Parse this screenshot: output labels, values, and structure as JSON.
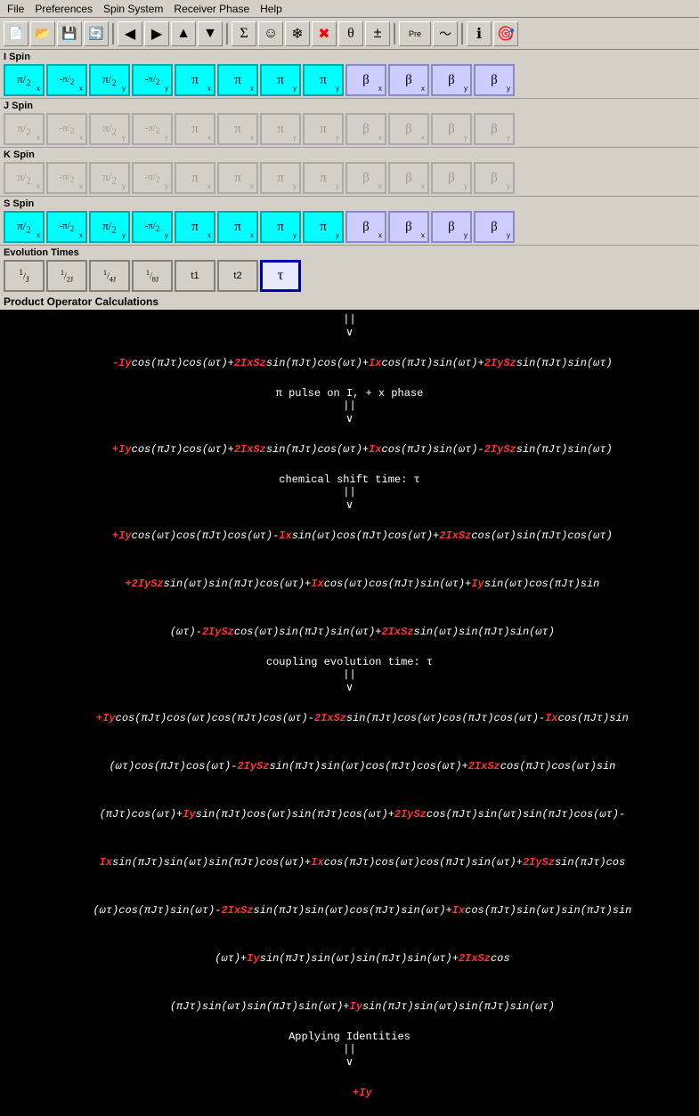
{
  "menubar": {
    "items": [
      "File",
      "Preferences",
      "Spin System",
      "Receiver Phase",
      "Help"
    ]
  },
  "toolbar": {
    "buttons": [
      {
        "name": "new",
        "icon": "📄"
      },
      {
        "name": "open",
        "icon": "📂"
      },
      {
        "name": "save",
        "icon": "💾"
      },
      {
        "name": "refresh",
        "icon": "🔄"
      },
      {
        "name": "back",
        "icon": "◀"
      },
      {
        "name": "forward",
        "icon": "▶"
      },
      {
        "name": "up",
        "icon": "▲"
      },
      {
        "name": "down",
        "icon": "▼"
      },
      {
        "name": "sigma",
        "icon": "Σ"
      },
      {
        "name": "smiley",
        "icon": "☺"
      },
      {
        "name": "asterisk",
        "icon": "✳"
      },
      {
        "name": "red-x",
        "icon": "✖"
      },
      {
        "name": "theta",
        "icon": "θ"
      },
      {
        "name": "plusminus",
        "icon": "±"
      },
      {
        "name": "preview",
        "icon": "Pre"
      },
      {
        "name": "wave",
        "icon": "〜"
      },
      {
        "name": "info",
        "icon": "ℹ"
      },
      {
        "name": "target",
        "icon": "🎯"
      }
    ]
  },
  "iSpin": {
    "label": "I Spin",
    "buttons": [
      {
        "label": "π/2",
        "sub": "x",
        "style": "cyan"
      },
      {
        "label": "-π/2",
        "sub": "x",
        "style": "cyan"
      },
      {
        "label": "π/2",
        "sub": "y",
        "style": "cyan"
      },
      {
        "label": "-π/2",
        "sub": "y",
        "style": "cyan"
      },
      {
        "label": "π",
        "sub": "x",
        "style": "cyan"
      },
      {
        "label": "π",
        "sub": "x",
        "style": "cyan"
      },
      {
        "label": "π",
        "sub": "y",
        "style": "cyan"
      },
      {
        "label": "π",
        "sub": "y",
        "style": "cyan"
      },
      {
        "label": "β",
        "sub": "x",
        "style": "lavender"
      },
      {
        "label": "β",
        "sub": "x",
        "style": "lavender"
      },
      {
        "label": "β",
        "sub": "y",
        "style": "lavender"
      },
      {
        "label": "β",
        "sub": "y",
        "style": "lavender"
      }
    ]
  },
  "jSpin": {
    "label": "J Spin",
    "buttons": [
      {
        "label": "π/2",
        "sub": "x",
        "style": "disabled"
      },
      {
        "label": "-π/2",
        "sub": "x",
        "style": "disabled"
      },
      {
        "label": "π/2",
        "sub": "y",
        "style": "disabled"
      },
      {
        "label": "-π/2",
        "sub": "y",
        "style": "disabled"
      },
      {
        "label": "π",
        "sub": "x",
        "style": "disabled"
      },
      {
        "label": "π",
        "sub": "x",
        "style": "disabled"
      },
      {
        "label": "π",
        "sub": "y",
        "style": "disabled"
      },
      {
        "label": "π",
        "sub": "y",
        "style": "disabled"
      },
      {
        "label": "β",
        "sub": "x",
        "style": "disabled"
      },
      {
        "label": "β",
        "sub": "x",
        "style": "disabled"
      },
      {
        "label": "β",
        "sub": "y",
        "style": "disabled"
      },
      {
        "label": "β",
        "sub": "y",
        "style": "disabled"
      }
    ]
  },
  "kSpin": {
    "label": "K Spin",
    "buttons": [
      {
        "label": "π/2",
        "sub": "x",
        "style": "disabled"
      },
      {
        "label": "-π/2",
        "sub": "x",
        "style": "disabled"
      },
      {
        "label": "π/2",
        "sub": "y",
        "style": "disabled"
      },
      {
        "label": "-π/2",
        "sub": "y",
        "style": "disabled"
      },
      {
        "label": "π",
        "sub": "x",
        "style": "disabled"
      },
      {
        "label": "π",
        "sub": "x",
        "style": "disabled"
      },
      {
        "label": "π",
        "sub": "y",
        "style": "disabled"
      },
      {
        "label": "π",
        "sub": "y",
        "style": "disabled"
      },
      {
        "label": "β",
        "sub": "x",
        "style": "disabled"
      },
      {
        "label": "β",
        "sub": "x",
        "style": "disabled"
      },
      {
        "label": "β",
        "sub": "y",
        "style": "disabled"
      },
      {
        "label": "β",
        "sub": "y",
        "style": "disabled"
      }
    ]
  },
  "sSpin": {
    "label": "S Spin",
    "buttons": [
      {
        "label": "π/2",
        "sub": "x",
        "style": "cyan"
      },
      {
        "label": "-π/2",
        "sub": "x",
        "style": "cyan"
      },
      {
        "label": "π/2",
        "sub": "y",
        "style": "cyan"
      },
      {
        "label": "-π/2",
        "sub": "y",
        "style": "cyan"
      },
      {
        "label": "π",
        "sub": "x",
        "style": "cyan"
      },
      {
        "label": "π",
        "sub": "x",
        "style": "cyan"
      },
      {
        "label": "π",
        "sub": "y",
        "style": "cyan"
      },
      {
        "label": "π",
        "sub": "y",
        "style": "cyan"
      },
      {
        "label": "β",
        "sub": "x",
        "style": "lavender"
      },
      {
        "label": "β",
        "sub": "x",
        "style": "lavender"
      },
      {
        "label": "β",
        "sub": "y",
        "style": "lavender"
      },
      {
        "label": "β",
        "sub": "y",
        "style": "lavender"
      }
    ]
  },
  "evolutionTimes": {
    "label": "Evolution Times",
    "buttons": [
      {
        "label": "1/J",
        "style": "normal"
      },
      {
        "label": "1/2J",
        "style": "normal"
      },
      {
        "label": "1/4J",
        "style": "normal"
      },
      {
        "label": "1/8J",
        "style": "normal"
      },
      {
        "label": "t1",
        "style": "normal"
      },
      {
        "label": "t2",
        "style": "normal"
      },
      {
        "label": "τ",
        "style": "selected"
      }
    ]
  },
  "productOperator": {
    "title": "Product Operator Calculations",
    "lines": [
      "||",
      "∨",
      "-Iy cos(πJτ)cos(ωτ)+2IxSz sin(πJτ)cos(ωτ)+Ix cos(πJτ)sin(ωτ)+2IySz sin(πJτ)sin(ωτ)",
      "π pulse on I, + x phase",
      "||",
      "∨",
      "+Iy cos(πJτ)cos(ωτ)+2IxSz sin(πJτ)cos(ωτ)+Ix cos(πJτ)sin(ωτ)-2IySz sin(πJτ)sin(ωτ)",
      "chemical shift time: τ",
      "||",
      "∨",
      "+Iy cos(ωτ)cos(πJτ)cos(ωτ)-Ix sin(ωτ)cos(πJτ)cos(ωτ)+2IxSz cos(ωτ)sin(πJτ)cos(ωτ)",
      "+2IySz sin(ωτ)sin(πJτ)cos(ωτ)+Ix cos(ωτ)cos(πJτ)sin(ωτ)+Iy sin(ωτ)cos(πJτ)sin",
      "(ωτ)-2IySz cos(ωτ)sin(πJτ)sin(ωτ)+2IxSz sin(ωτ)sin(πJτ)sin(ωτ)",
      "coupling evolution time: τ",
      "||",
      "∨",
      "+Iy cos(πJτ)cos(ωτ)cos(πJτ)cos(ωτ)-2IxSz sin(πJτ)cos(ωτ)cos(πJτ)cos(ωτ)-Ix cos(πJτ)sin",
      "(ωτ)cos(πJτ)cos(ωτ)-2IySz sin(πJτ)sin(ωτ)cos(πJτ)cos(ωτ)+2IxSz cos(πJτ)cos(ωτ)sin",
      "(πJτ)cos(ωτ)+Iy sin(πJτ)cos(ωτ)sin(πJτ)cos(ωτ)+2IySz cos(πJτ)sin(ωτ)sin(πJτ)cos(ωτ)-",
      "Ix sin(πJτ)sin(ωτ)sin(πJτ)cos(ωτ)+Ix cos(πJτ)cos(ωτ)cos(πJτ)sin(ωτ)+2IySz sin(πJτ)cos",
      "(ωτ)cos(πJτ)sin(ωτ)-2IxSz sin(πJτ)sin(ωτ)cos(πJτ)sin(ωτ)+Ix cos(πJτ)sin(ωτ)sin(πJτ)sin",
      "(ωτ)+Iy sin(πJτ)sin(ωτ)sin(πJτ)sin(ωτ)+2IxSz cos",
      "(πJτ)sin(ωτ)sin(πJτ)sin(ωτ)+Iy sin(πJτ)sin(ωτ)sin(πJτ)sin(ωτ)",
      "Applying Identities",
      "||",
      "∨",
      "+Iy"
    ]
  }
}
